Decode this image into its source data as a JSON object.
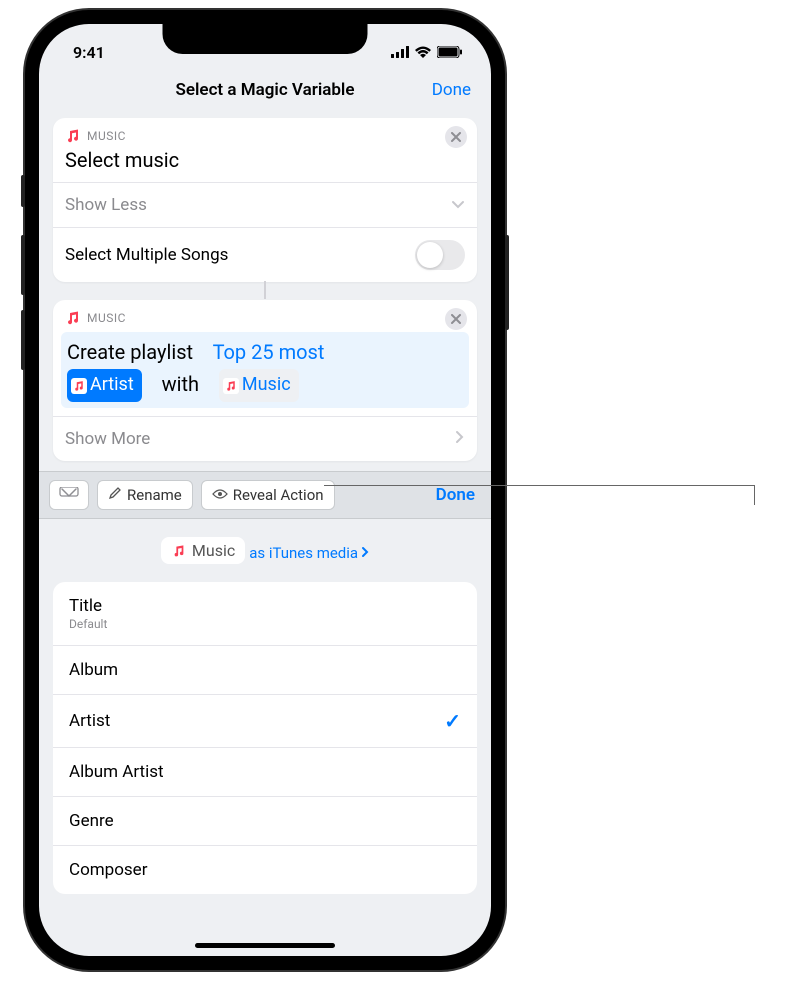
{
  "status": {
    "time": "9:41"
  },
  "nav": {
    "title": "Select a Magic Variable",
    "done": "Done"
  },
  "card1": {
    "app": "MUSIC",
    "title": "Select music",
    "showLess": "Show Less",
    "multi": "Select Multiple Songs"
  },
  "card2": {
    "app": "MUSIC",
    "prefix": "Create playlist",
    "name": "Top 25 most",
    "token1": "Artist",
    "mid": "with",
    "token2": "Music",
    "showMore": "Show More"
  },
  "toolbar": {
    "rename": "Rename",
    "reveal": "Reveal Action",
    "done": "Done"
  },
  "panel": {
    "badge": "Music",
    "sub": "as iTunes media"
  },
  "attrs": [
    {
      "label": "Title",
      "sub": "Default",
      "selected": false
    },
    {
      "label": "Album",
      "selected": false
    },
    {
      "label": "Artist",
      "selected": true
    },
    {
      "label": "Album Artist",
      "selected": false
    },
    {
      "label": "Genre",
      "selected": false
    },
    {
      "label": "Composer",
      "selected": false
    }
  ]
}
